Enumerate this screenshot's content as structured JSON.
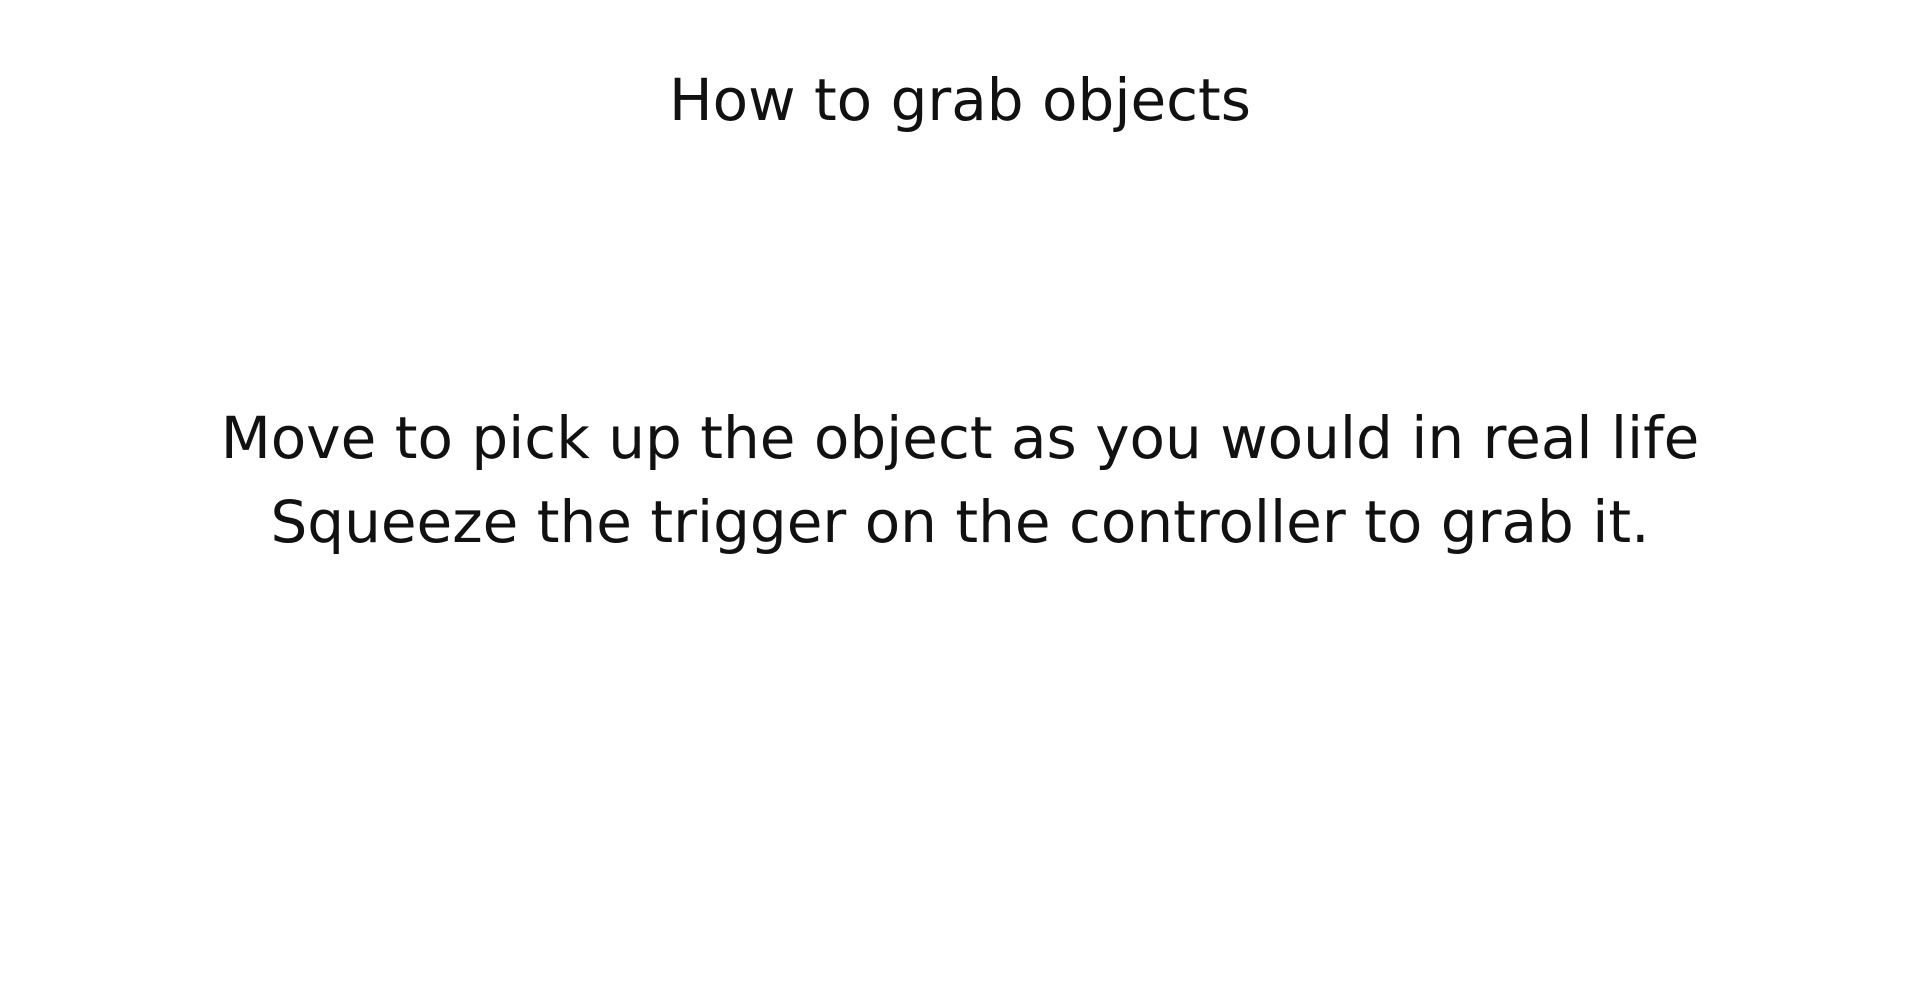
{
  "tutorial": {
    "title": "How to grab objects",
    "lines": [
      "Move to pick up the object as you would in real life",
      "Squeeze the trigger on the controller to grab it."
    ]
  }
}
